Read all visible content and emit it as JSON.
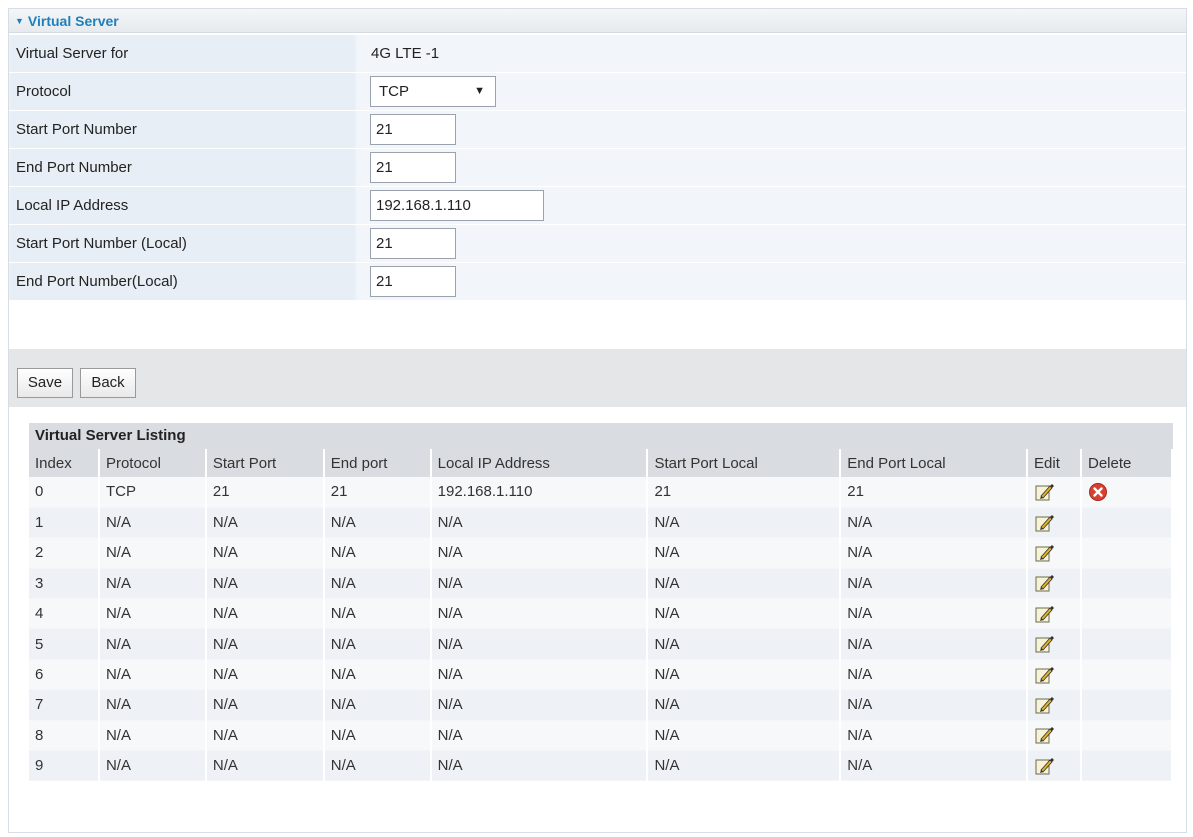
{
  "section": {
    "title": "Virtual Server"
  },
  "form": {
    "virtual_server_for": {
      "label": "Virtual Server for",
      "value": "4G LTE -1"
    },
    "protocol": {
      "label": "Protocol",
      "selected": "TCP"
    },
    "start_port": {
      "label": "Start Port Number",
      "value": "21"
    },
    "end_port": {
      "label": "End Port Number",
      "value": "21"
    },
    "local_ip": {
      "label": "Local IP Address",
      "value": "192.168.1.110"
    },
    "start_port_local": {
      "label": "Start Port Number (Local)",
      "value": "21"
    },
    "end_port_local": {
      "label": "End Port Number(Local)",
      "value": "21"
    }
  },
  "buttons": {
    "save": "Save",
    "back": "Back"
  },
  "listing": {
    "title": "Virtual Server Listing",
    "columns": [
      "Index",
      "Protocol",
      "Start Port",
      "End port",
      "Local IP Address",
      "Start Port Local",
      "End Port Local",
      "Edit",
      "Delete"
    ],
    "rows": [
      {
        "index": "0",
        "protocol": "TCP",
        "start_port": "21",
        "end_port": "21",
        "local_ip": "192.168.1.110",
        "start_port_local": "21",
        "end_port_local": "21",
        "deletable": true
      },
      {
        "index": "1",
        "protocol": "N/A",
        "start_port": "N/A",
        "end_port": "N/A",
        "local_ip": "N/A",
        "start_port_local": "N/A",
        "end_port_local": "N/A",
        "deletable": false
      },
      {
        "index": "2",
        "protocol": "N/A",
        "start_port": "N/A",
        "end_port": "N/A",
        "local_ip": "N/A",
        "start_port_local": "N/A",
        "end_port_local": "N/A",
        "deletable": false
      },
      {
        "index": "3",
        "protocol": "N/A",
        "start_port": "N/A",
        "end_port": "N/A",
        "local_ip": "N/A",
        "start_port_local": "N/A",
        "end_port_local": "N/A",
        "deletable": false
      },
      {
        "index": "4",
        "protocol": "N/A",
        "start_port": "N/A",
        "end_port": "N/A",
        "local_ip": "N/A",
        "start_port_local": "N/A",
        "end_port_local": "N/A",
        "deletable": false
      },
      {
        "index": "5",
        "protocol": "N/A",
        "start_port": "N/A",
        "end_port": "N/A",
        "local_ip": "N/A",
        "start_port_local": "N/A",
        "end_port_local": "N/A",
        "deletable": false
      },
      {
        "index": "6",
        "protocol": "N/A",
        "start_port": "N/A",
        "end_port": "N/A",
        "local_ip": "N/A",
        "start_port_local": "N/A",
        "end_port_local": "N/A",
        "deletable": false
      },
      {
        "index": "7",
        "protocol": "N/A",
        "start_port": "N/A",
        "end_port": "N/A",
        "local_ip": "N/A",
        "start_port_local": "N/A",
        "end_port_local": "N/A",
        "deletable": false
      },
      {
        "index": "8",
        "protocol": "N/A",
        "start_port": "N/A",
        "end_port": "N/A",
        "local_ip": "N/A",
        "start_port_local": "N/A",
        "end_port_local": "N/A",
        "deletable": false
      },
      {
        "index": "9",
        "protocol": "N/A",
        "start_port": "N/A",
        "end_port": "N/A",
        "local_ip": "N/A",
        "start_port_local": "N/A",
        "end_port_local": "N/A",
        "deletable": false
      }
    ]
  },
  "icons": {
    "edit": "edit-pencil-icon",
    "delete": "delete-x-icon",
    "section_toggle": "collapse-caret-icon"
  },
  "colors": {
    "title_accent": "#1f7fb8",
    "delete_red": "#d8402f"
  }
}
